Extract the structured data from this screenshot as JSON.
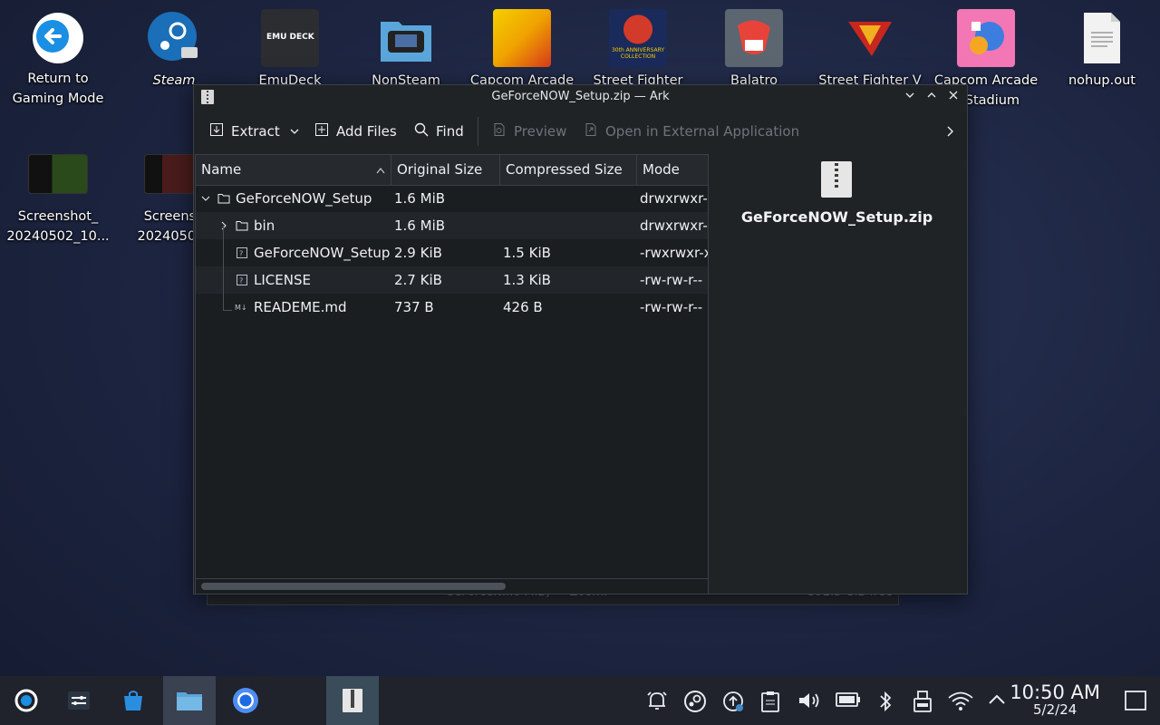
{
  "desktop": {
    "icons": [
      {
        "label": "Return to\nGaming Mode"
      },
      {
        "label": "Steam"
      },
      {
        "label": "EmuDeck"
      },
      {
        "label": "NonSteam"
      },
      {
        "label": "Capcom Arcade"
      },
      {
        "label": "Street Fighter"
      },
      {
        "label": "Balatro"
      },
      {
        "label": "Street Fighter V"
      },
      {
        "label": "Capcom Arcade\nd Stadium"
      },
      {
        "label": "nohup.out"
      },
      {
        "label": "Screenshot_\n20240502_10..."
      },
      {
        "label": "Screensh\n20240502_"
      }
    ],
    "emudeck_logo_text": "EMU DECK",
    "sf30_text": "30th ANNIVERSARY COLLECTION"
  },
  "ghost_window": {
    "status_left": "GeForceN...o MiB) — Zoom:",
    "status_right": "392.5 GiB free"
  },
  "window": {
    "title": "GeForceNOW_Setup.zip — Ark",
    "toolbar": {
      "extract": "Extract",
      "add_files": "Add Files",
      "find": "Find",
      "preview": "Preview",
      "open_external": "Open in External Application"
    },
    "columns": [
      "Name",
      "Original Size",
      "Compressed Size",
      "Mode"
    ],
    "rows": [
      {
        "name": "GeForceNOW_Setup",
        "orig": "1.6 MiB",
        "comp": "",
        "mode": "drwxrwxr-x"
      },
      {
        "name": "bin",
        "orig": "1.6 MiB",
        "comp": "",
        "mode": "drwxrwxr-x"
      },
      {
        "name": "GeForceNOW_Setup",
        "orig": "2.9 KiB",
        "comp": "1.5 KiB",
        "mode": "-rwxrwxr-x"
      },
      {
        "name": "LICENSE",
        "orig": "2.7 KiB",
        "comp": "1.3 KiB",
        "mode": "-rw-rw-r--"
      },
      {
        "name": "READEME.md",
        "orig": "737 B",
        "comp": "426 B",
        "mode": "-rw-rw-r--"
      }
    ],
    "preview_name": "GeForceNOW_Setup.zip"
  },
  "taskbar": {
    "time": "10:50 AM",
    "date": "5/2/24"
  },
  "colors": {
    "accent": "#3f89c6",
    "window_bg": "#202326",
    "taskbar_bg": "#20232b"
  }
}
